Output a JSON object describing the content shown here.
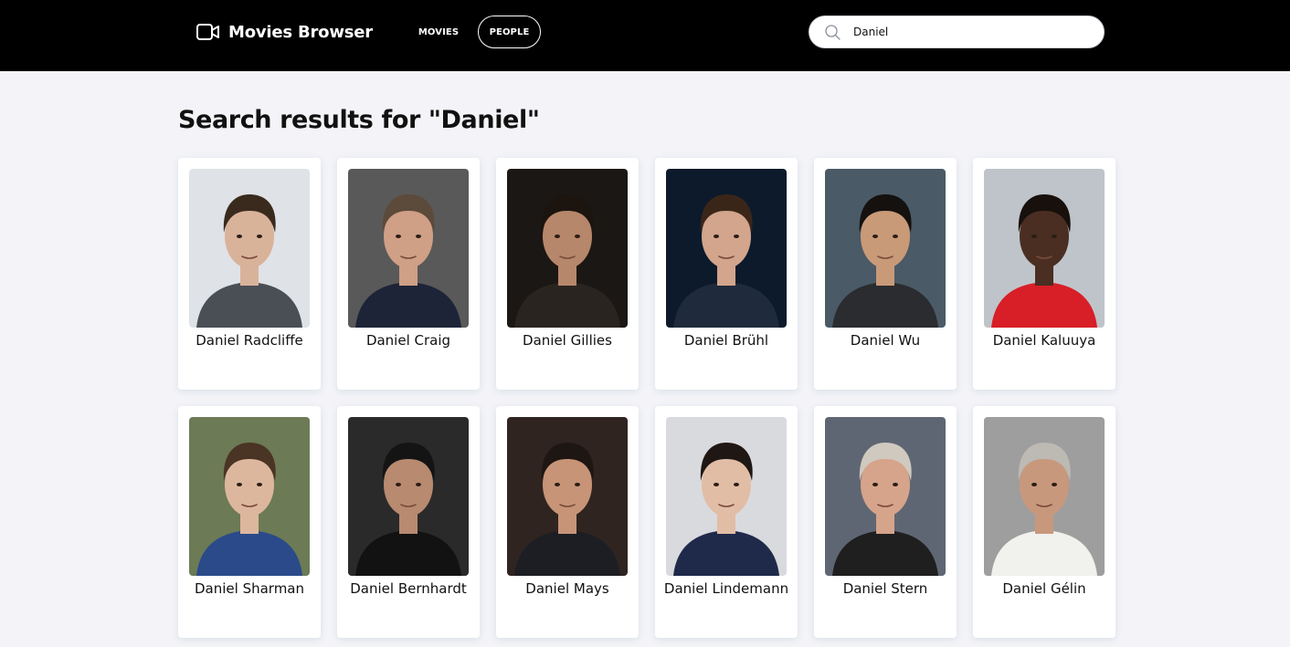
{
  "header": {
    "brand_icon": "video-camera-icon",
    "brand_title": "Movies Browser",
    "nav": [
      {
        "label": "MOVIES",
        "active": false
      },
      {
        "label": "PEOPLE",
        "active": true
      }
    ],
    "search": {
      "icon": "search-icon",
      "value": "Daniel"
    }
  },
  "page_title": "Search results for \"Daniel\"",
  "people": [
    {
      "name": "Daniel Radcliffe",
      "photo": {
        "bg": "#dfe2e6",
        "skin": "#d9b29a",
        "hair": "#3a2a1e",
        "shirt": "#4a4e55"
      }
    },
    {
      "name": "Daniel Craig",
      "photo": {
        "bg": "#595959",
        "skin": "#cf9f86",
        "hair": "#5c4a3a",
        "shirt": "#1d2438"
      }
    },
    {
      "name": "Daniel Gillies",
      "photo": {
        "bg": "#1b1714",
        "skin": "#b6876a",
        "hair": "#1c140f",
        "shirt": "#2a2420"
      }
    },
    {
      "name": "Daniel Brühl",
      "photo": {
        "bg": "#0c1a2c",
        "skin": "#d2a58c",
        "hair": "#3a2618",
        "shirt": "#1f2a3c"
      }
    },
    {
      "name": "Daniel Wu",
      "photo": {
        "bg": "#4a5a66",
        "skin": "#c99a78",
        "hair": "#14110f",
        "shirt": "#2a2c2f"
      }
    },
    {
      "name": "Daniel Kaluuya",
      "photo": {
        "bg": "#bfc4ca",
        "skin": "#4a2e22",
        "hair": "#17100c",
        "shirt": "#d81e26"
      }
    },
    {
      "name": "Daniel Sharman",
      "photo": {
        "bg": "#6c7a55",
        "skin": "#ddb79d",
        "hair": "#4a3424",
        "shirt": "#2a4a8a"
      }
    },
    {
      "name": "Daniel Bernhardt",
      "photo": {
        "bg": "#2a2a2a",
        "skin": "#b88a70",
        "hair": "#141414",
        "shirt": "#121212"
      }
    },
    {
      "name": "Daniel Mays",
      "photo": {
        "bg": "#2f2420",
        "skin": "#c79478",
        "hair": "#1e1612",
        "shirt": "#1c1e24"
      }
    },
    {
      "name": "Daniel Lindemann",
      "photo": {
        "bg": "#d9dade",
        "skin": "#e2bda5",
        "hair": "#1f1713",
        "shirt": "#1f2a4a"
      }
    },
    {
      "name": "Daniel Stern",
      "photo": {
        "bg": "#5f6673",
        "skin": "#d6a48a",
        "hair": "#cfc9bf",
        "shirt": "#1f1f1f"
      }
    },
    {
      "name": "Daniel Gélin",
      "photo": {
        "bg": "#9e9e9e",
        "skin": "#c8987d",
        "hair": "#bdb9b3",
        "shirt": "#f1f1ee"
      }
    }
  ]
}
